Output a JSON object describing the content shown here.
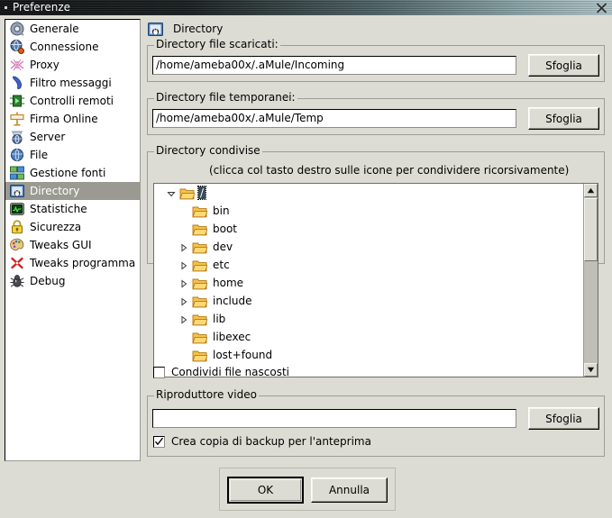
{
  "window": {
    "title": "Preferenze",
    "close_icon": "close-icon"
  },
  "sidebar": {
    "items": [
      {
        "label": "Generale",
        "icon": "general-gear-icon",
        "selected": false
      },
      {
        "label": "Connessione",
        "icon": "connection-globe-icon",
        "selected": false
      },
      {
        "label": "Proxy",
        "icon": "proxy-icon",
        "selected": false
      },
      {
        "label": "Filtro messaggi",
        "icon": "message-filter-icon",
        "selected": false
      },
      {
        "label": "Controlli remoti",
        "icon": "remote-controls-icon",
        "selected": false
      },
      {
        "label": "Firma Online",
        "icon": "online-signature-icon",
        "selected": false
      },
      {
        "label": "Server",
        "icon": "server-icon",
        "selected": false
      },
      {
        "label": "File",
        "icon": "file-icon",
        "selected": false
      },
      {
        "label": "Gestione fonti",
        "icon": "source-manager-icon",
        "selected": false
      },
      {
        "label": "Directory",
        "icon": "directory-icon",
        "selected": true
      },
      {
        "label": "Statistiche",
        "icon": "statistics-icon",
        "selected": false
      },
      {
        "label": "Sicurezza",
        "icon": "security-lock-icon",
        "selected": false
      },
      {
        "label": "Tweaks GUI",
        "icon": "gui-tweaks-palette-icon",
        "selected": false
      },
      {
        "label": "Tweaks programma",
        "icon": "program-tweaks-icon",
        "selected": false
      },
      {
        "label": "Debug",
        "icon": "debug-bug-icon",
        "selected": false
      }
    ]
  },
  "pane": {
    "header_title": "Directory",
    "header_icon": "directory-icon",
    "downloads_group": {
      "legend": "Directory file scaricati:",
      "value": "/home/ameba00x/.aMule/Incoming",
      "browse_label": "Sfoglia"
    },
    "temp_group": {
      "legend": "Directory file temporanei:",
      "value": "/home/ameba00x/.aMule/Temp",
      "browse_label": "Sfoglia"
    },
    "shared_group": {
      "legend": "Directory condivise",
      "hint": "(clicca col tasto destro sulle icone per condividere ricorsivamente)",
      "tree": [
        {
          "label": "/",
          "depth": 0,
          "arrow": "expanded",
          "selected": true
        },
        {
          "label": "bin",
          "depth": 1,
          "arrow": "none",
          "selected": false
        },
        {
          "label": "boot",
          "depth": 1,
          "arrow": "none",
          "selected": false
        },
        {
          "label": "dev",
          "depth": 1,
          "arrow": "collapsed",
          "selected": false
        },
        {
          "label": "etc",
          "depth": 1,
          "arrow": "collapsed",
          "selected": false
        },
        {
          "label": "home",
          "depth": 1,
          "arrow": "collapsed",
          "selected": false
        },
        {
          "label": "include",
          "depth": 1,
          "arrow": "collapsed",
          "selected": false
        },
        {
          "label": "lib",
          "depth": 1,
          "arrow": "collapsed",
          "selected": false
        },
        {
          "label": "libexec",
          "depth": 1,
          "arrow": "none",
          "selected": false
        },
        {
          "label": "lost+found",
          "depth": 1,
          "arrow": "none",
          "selected": false
        }
      ],
      "hidden_checkbox": {
        "label": "Condividi file nascosti",
        "checked": false
      }
    },
    "video_group": {
      "legend": "Riproduttore video",
      "value": "",
      "browse_label": "Sfoglia",
      "backup_checkbox": {
        "label": "Crea copia di backup per l'anteprima",
        "checked": true
      }
    }
  },
  "footer": {
    "ok_label": "OK",
    "cancel_label": "Annulla"
  },
  "colors": {
    "face": "#dcdcd4",
    "selection": "#9a9a93",
    "tree_selection": "#3b4a56",
    "folder": "#f0a42a"
  }
}
